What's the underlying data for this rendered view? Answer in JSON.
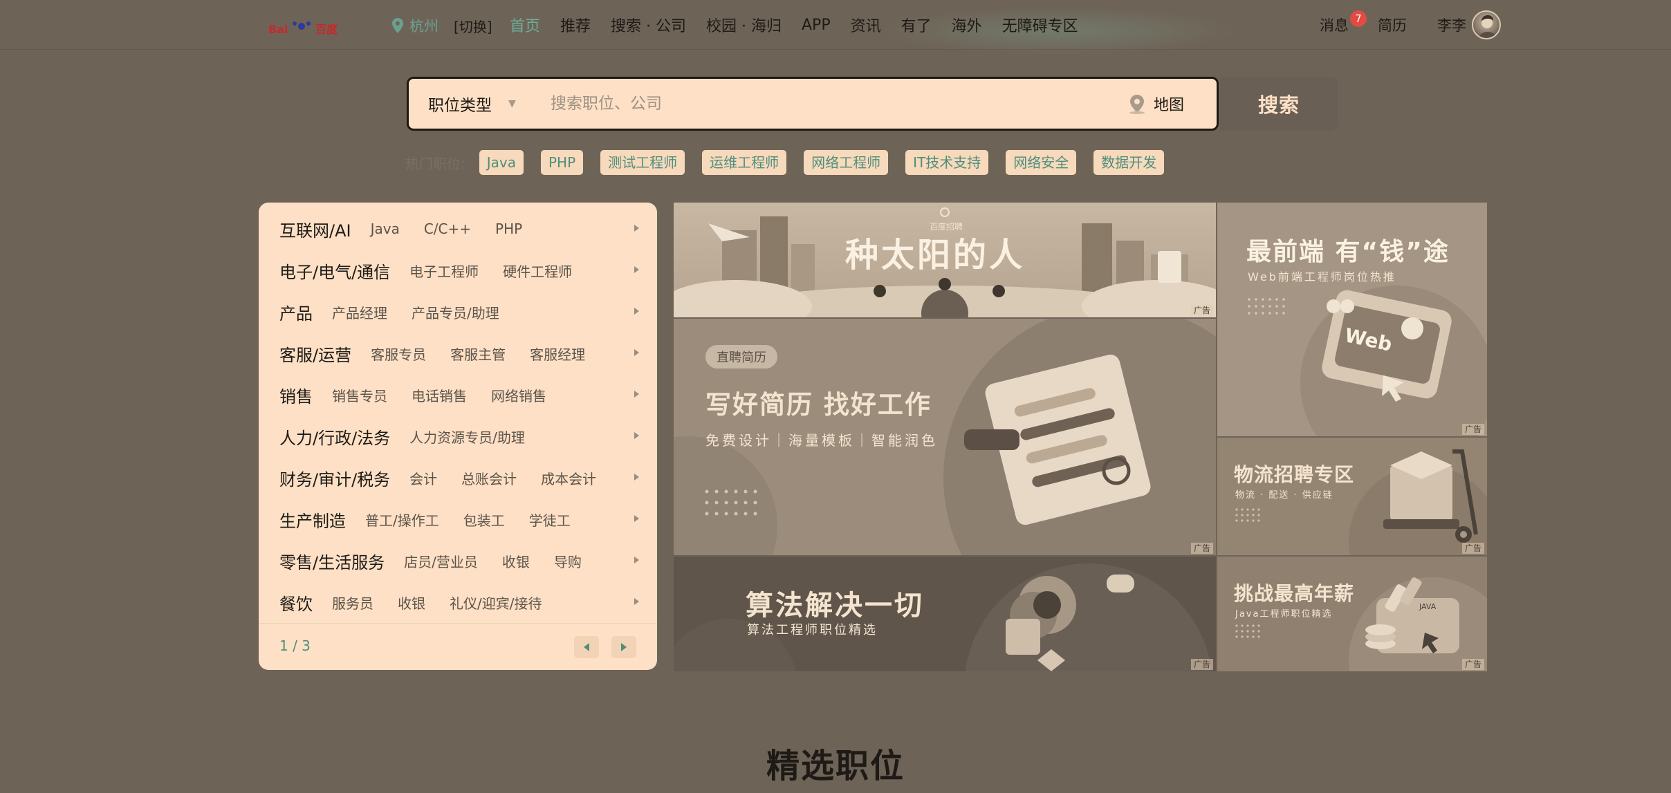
{
  "nav": {
    "location": "杭州",
    "switch": "[切换]",
    "links": [
      "首页",
      "推荐",
      "搜索 · 公司",
      "校园 · 海归",
      "APP",
      "资讯",
      "有了",
      "海外",
      "无障碍专区"
    ],
    "active_index": 0,
    "messages": "消息",
    "message_count": "7",
    "resume": "简历",
    "username": "李李"
  },
  "search": {
    "type_label": "职位类型",
    "placeholder": "搜索职位、公司",
    "map": "地图",
    "button": "搜索"
  },
  "hot": {
    "label": "热门职位:",
    "tags": [
      "Java",
      "PHP",
      "测试工程师",
      "运维工程师",
      "网络工程师",
      "IT技术支持",
      "网络安全",
      "数据开发"
    ]
  },
  "categories": [
    {
      "title": "互联网/AI",
      "subs": [
        "Java",
        "C/C++",
        "PHP"
      ]
    },
    {
      "title": "电子/电气/通信",
      "subs": [
        "电子工程师",
        "硬件工程师"
      ]
    },
    {
      "title": "产品",
      "subs": [
        "产品经理",
        "产品专员/助理"
      ]
    },
    {
      "title": "客服/运营",
      "subs": [
        "客服专员",
        "客服主管",
        "客服经理"
      ]
    },
    {
      "title": "销售",
      "subs": [
        "销售专员",
        "电话销售",
        "网络销售"
      ]
    },
    {
      "title": "人力/行政/法务",
      "subs": [
        "人力资源专员/助理"
      ]
    },
    {
      "title": "财务/审计/税务",
      "subs": [
        "会计",
        "总账会计",
        "成本会计"
      ]
    },
    {
      "title": "生产制造",
      "subs": [
        "普工/操作工",
        "包装工",
        "学徒工"
      ]
    },
    {
      "title": "零售/生活服务",
      "subs": [
        "店员/营业员",
        "收银",
        "导购"
      ]
    },
    {
      "title": "餐饮",
      "subs": [
        "服务员",
        "收银",
        "礼仪/迎宾/接待"
      ]
    }
  ],
  "pager": "1 / 3",
  "banners": {
    "ad_label": "广告",
    "sun_title": "种太阳的人",
    "sun_brand": "百度招聘",
    "resume_badge": "直聘简历",
    "resume_title_1": "写好简历",
    "resume_title_2": "找好工作",
    "resume_subtitle": "免费设计｜海量模板｜智能润色",
    "algo_title": "算法解决一切",
    "algo_subtitle": "算法工程师职位精选",
    "fe_title": "最前端 有“钱”途",
    "fe_subtitle": "Web前端工程师岗位热推",
    "fe_art_text": "Web",
    "logistics_title": "物流招聘专区",
    "logistics_subtitle": "物流 · 配送 · 供应链",
    "salary_title": "挑战最高年薪",
    "salary_subtitle": "Java工程师职位精选",
    "salary_art_text": "JAVA"
  },
  "section_title": "精选职位"
}
